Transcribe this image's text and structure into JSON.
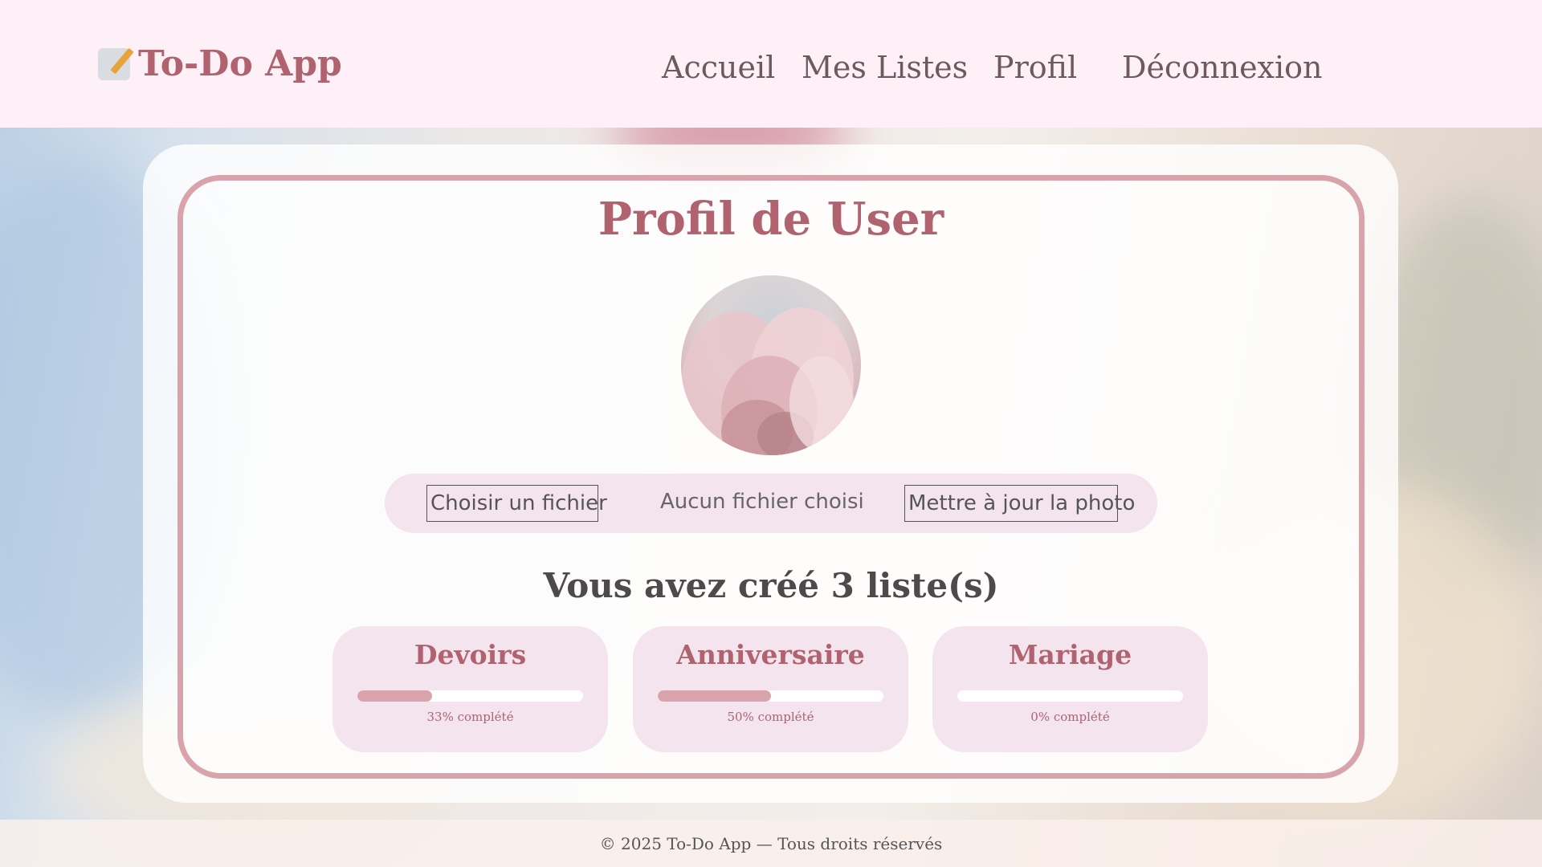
{
  "header": {
    "logo_text": "To-Do App",
    "nav": {
      "home": "Accueil",
      "lists": "Mes Listes",
      "profile": "Profil",
      "logout": "Déconnexion"
    }
  },
  "profile": {
    "title": "Profil de User",
    "upload": {
      "choose_file": "Choisir un fichier",
      "no_file": "Aucun fichier choisi",
      "update_photo": "Mettre à jour la photo"
    },
    "lists_heading": "Vous avez créé 3 liste(s)",
    "lists": [
      {
        "name": "Devoirs",
        "progress": 0.33,
        "progress_label": "33% complété"
      },
      {
        "name": "Anniversaire",
        "progress": 0.5,
        "progress_label": "50% complété"
      },
      {
        "name": "Mariage",
        "progress": 0,
        "progress_label": "0% complété"
      }
    ]
  },
  "footer": {
    "text": "© 2025 To-Do App — Tous droits réservés"
  },
  "colors": {
    "accent": "#b0626f",
    "header_bg": "#fdf0f6",
    "card_bg": "#f3e4ee",
    "progress": "#d9a3ab"
  },
  "icons": {
    "logo": "memo-pencil-icon"
  }
}
